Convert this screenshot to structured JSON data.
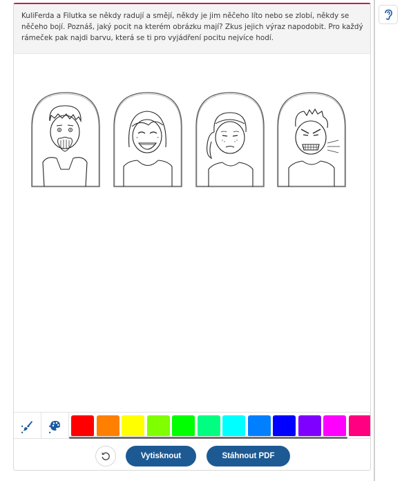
{
  "instruction": {
    "text": "KuliFerda a Filutka se někdy radují a smějí, někdy je jim něčeho líto nebo se zlobí, někdy se něčeho bojí. Poznáš, jaký pocit na kterém obrázku mají? Zkus jejich výraz napodobit. Pro každý rámeček pak najdi barvu, která se ti pro vyjádření pocitu nejvíce hodí."
  },
  "frames": [
    {
      "name": "frame-scared-boy",
      "emotion": "fear"
    },
    {
      "name": "frame-laughing-girl",
      "emotion": "joy"
    },
    {
      "name": "frame-sad-girl",
      "emotion": "sadness"
    },
    {
      "name": "frame-angry-boy",
      "emotion": "anger"
    }
  ],
  "tools": [
    {
      "name": "brush-tool-button",
      "icon": "brush-icon"
    },
    {
      "name": "palette-tool-button",
      "icon": "palette-icon"
    }
  ],
  "palette": [
    "#ff0000",
    "#ff7f00",
    "#ffff00",
    "#80ff00",
    "#00ff00",
    "#00ff80",
    "#00ffff",
    "#0080ff",
    "#0000ff",
    "#8000ff",
    "#ff00ff",
    "#ff0080"
  ],
  "footer": {
    "print_label": "Vytisknout",
    "pdf_label": "Stáhnout PDF"
  },
  "colors": {
    "accent": "#c2185b",
    "button": "#1d5a94"
  }
}
